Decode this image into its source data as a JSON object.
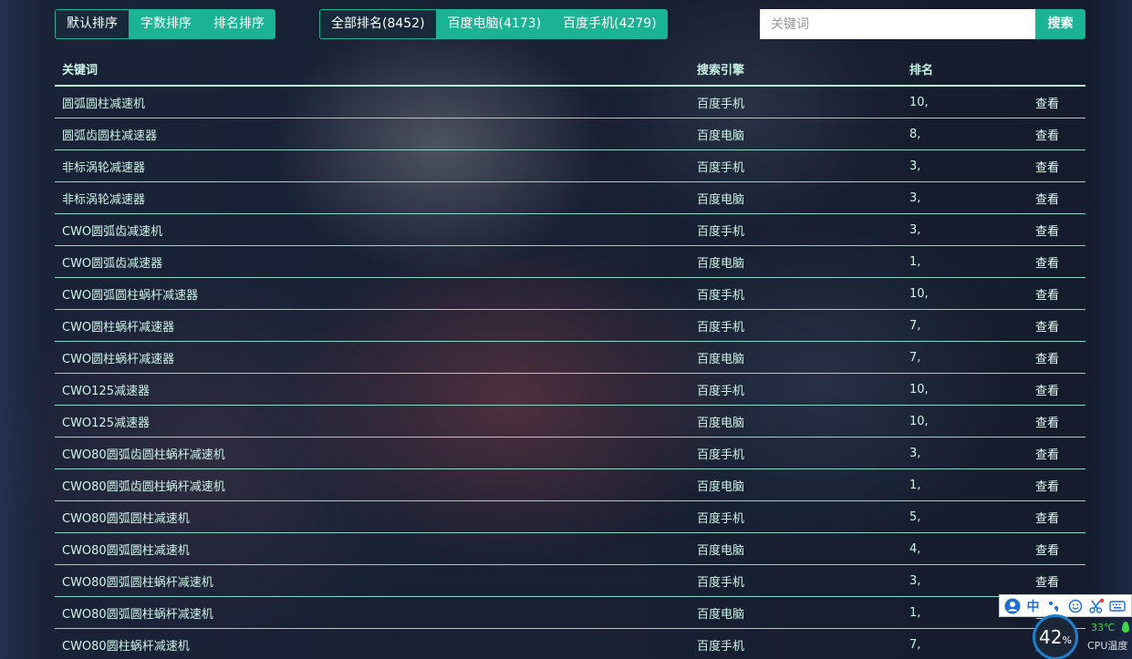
{
  "sort_options": [
    {
      "label": "默认排序",
      "active": true
    },
    {
      "label": "字数排序",
      "active": false
    },
    {
      "label": "排名排序",
      "active": false
    }
  ],
  "engine_filters": [
    {
      "label": "全部排名(8452)",
      "active": true
    },
    {
      "label": "百度电脑(4173)",
      "active": false
    },
    {
      "label": "百度手机(4279)",
      "active": false
    }
  ],
  "search": {
    "placeholder": "关键词",
    "button_label": "搜索"
  },
  "table": {
    "headers": {
      "keyword": "关键词",
      "engine": "搜索引擎",
      "rank": "排名"
    },
    "view_label": "查看",
    "rows": [
      {
        "keyword": "圆弧圆柱减速机",
        "engine": "百度手机",
        "rank": "10,"
      },
      {
        "keyword": "圆弧齿圆柱减速器",
        "engine": "百度电脑",
        "rank": "8,"
      },
      {
        "keyword": "非标涡轮减速器",
        "engine": "百度手机",
        "rank": "3,"
      },
      {
        "keyword": "非标涡轮减速器",
        "engine": "百度电脑",
        "rank": "3,"
      },
      {
        "keyword": "CWO圆弧齿减速机",
        "engine": "百度手机",
        "rank": "3,"
      },
      {
        "keyword": "CWO圆弧齿减速器",
        "engine": "百度电脑",
        "rank": "1,"
      },
      {
        "keyword": "CWO圆弧圆柱蜗杆减速器",
        "engine": "百度手机",
        "rank": "10,"
      },
      {
        "keyword": "CWO圆柱蜗杆减速器",
        "engine": "百度手机",
        "rank": "7,"
      },
      {
        "keyword": "CWO圆柱蜗杆减速器",
        "engine": "百度电脑",
        "rank": "7,"
      },
      {
        "keyword": "CWO125减速器",
        "engine": "百度手机",
        "rank": "10,"
      },
      {
        "keyword": "CWO125减速器",
        "engine": "百度电脑",
        "rank": "10,"
      },
      {
        "keyword": "CWO80圆弧齿圆柱蜗杆减速机",
        "engine": "百度手机",
        "rank": "3,"
      },
      {
        "keyword": "CWO80圆弧齿圆柱蜗杆减速机",
        "engine": "百度电脑",
        "rank": "1,"
      },
      {
        "keyword": "CWO80圆弧圆柱减速机",
        "engine": "百度手机",
        "rank": "5,"
      },
      {
        "keyword": "CWO80圆弧圆柱减速机",
        "engine": "百度电脑",
        "rank": "4,"
      },
      {
        "keyword": "CWO80圆弧圆柱蜗杆减速机",
        "engine": "百度手机",
        "rank": "3,"
      },
      {
        "keyword": "CWO80圆弧圆柱蜗杆减速机",
        "engine": "百度电脑",
        "rank": "1,"
      },
      {
        "keyword": "CWO80圆柱蜗杆减速机",
        "engine": "百度手机",
        "rank": "7,"
      }
    ]
  },
  "ime_toolbar": {
    "lang_label": "中",
    "icons": [
      "user-icon",
      "punctuation-icon",
      "emoji-icon",
      "scissors-icon",
      "keyboard-icon"
    ]
  },
  "cpu_widget": {
    "usage_value": "42",
    "usage_unit": "%",
    "temperature": "33℃",
    "label": "CPU温度"
  },
  "colors": {
    "accent": "#1ab394",
    "row_text": "#cdf5e7",
    "row_divider": "#8fd8c4"
  }
}
